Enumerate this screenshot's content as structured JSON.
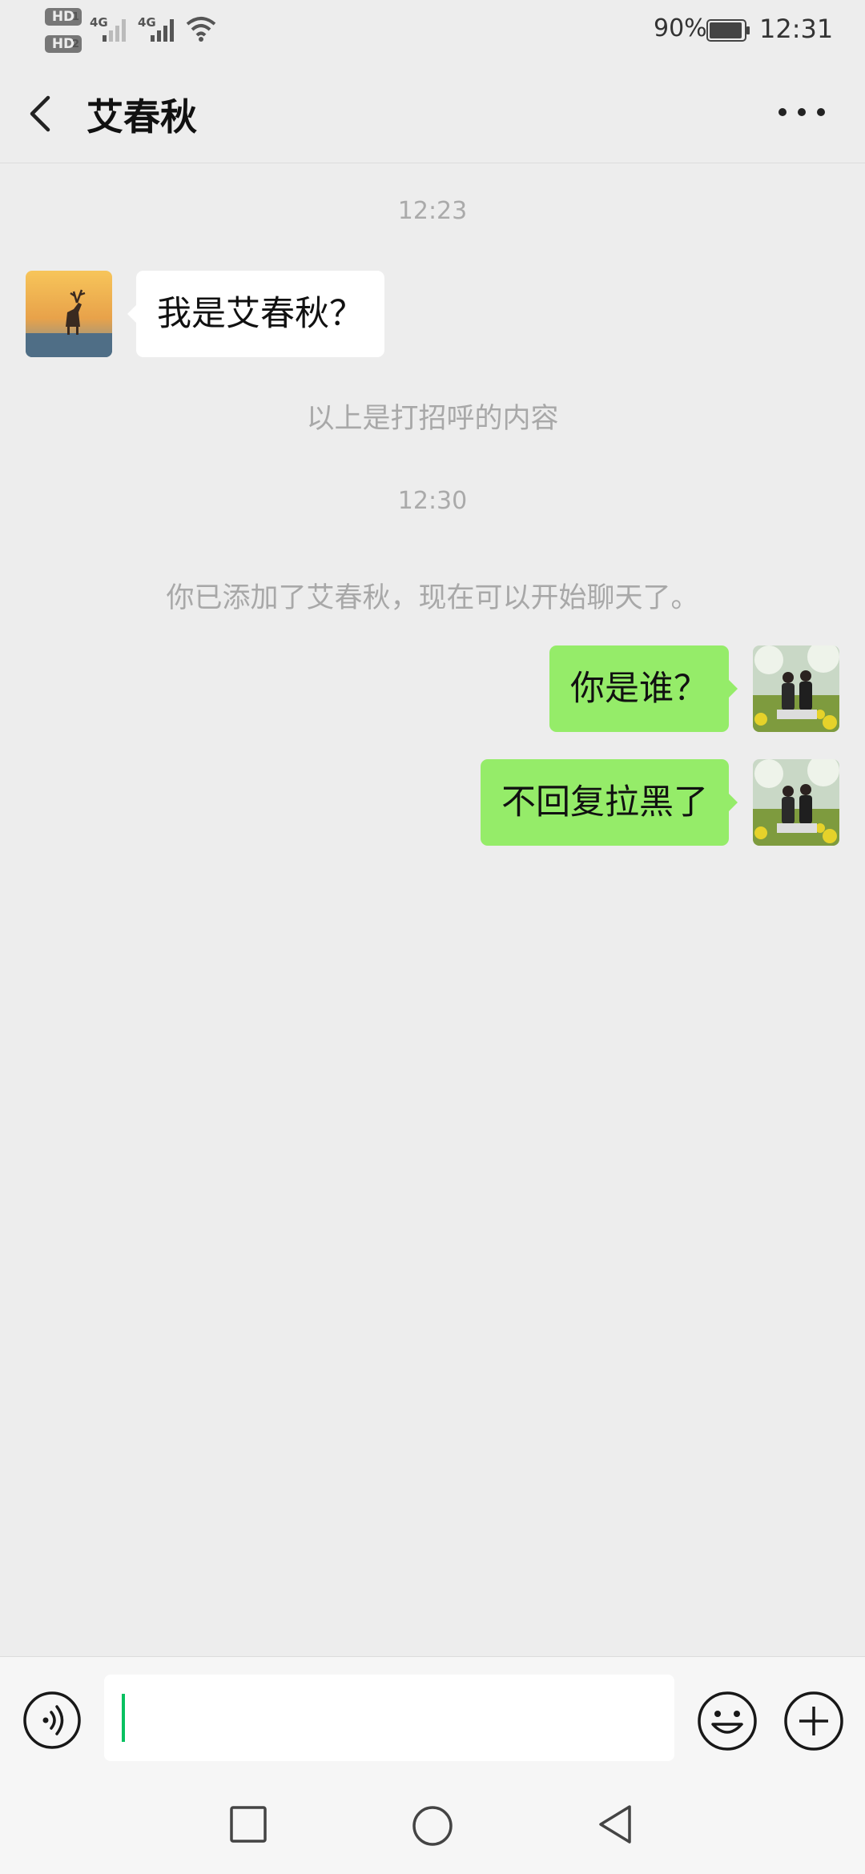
{
  "status_bar": {
    "sim1": "HD",
    "sim1_slot": "1",
    "sim2": "HD",
    "sim2_slot": "2",
    "net1": "4G",
    "net2": "4G",
    "battery_pct": "90%",
    "time": "12:31"
  },
  "header": {
    "title": "艾春秋",
    "back_icon": "chevron-left-icon",
    "more_icon": "more-horizontal-icon"
  },
  "messages": [
    {
      "type": "time",
      "text": "12:23"
    },
    {
      "type": "incoming",
      "text": "我是艾春秋？",
      "avatar": "deer-sunset-avatar"
    },
    {
      "type": "system",
      "text": "以上是打招呼的内容"
    },
    {
      "type": "time",
      "text": "12:30"
    },
    {
      "type": "system",
      "text": "你已添加了艾春秋，现在可以开始聊天了。"
    },
    {
      "type": "outgoing",
      "text": "你是谁？",
      "avatar": "couple-photo-avatar"
    },
    {
      "type": "outgoing",
      "text": "不回复拉黑了",
      "avatar": "couple-photo-avatar"
    }
  ],
  "input_bar": {
    "voice_icon": "voice-icon",
    "input_value": "",
    "emoji_icon": "emoji-icon",
    "plus_icon": "plus-circle-icon"
  },
  "nav_bar": {
    "recent_icon": "square-recent-icon",
    "home_icon": "circle-home-icon",
    "back_icon": "triangle-back-icon"
  },
  "colors": {
    "background": "#ededed",
    "outgoing_bubble": "#95ec69",
    "incoming_bubble": "#ffffff",
    "caret": "#07c160"
  }
}
